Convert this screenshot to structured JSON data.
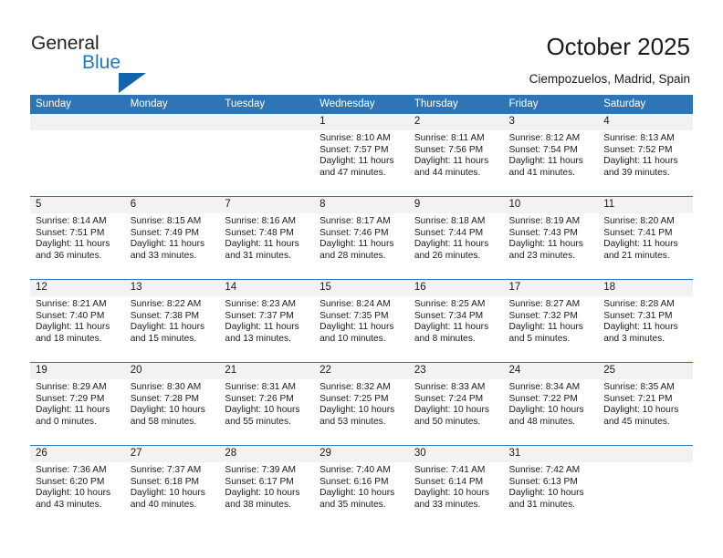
{
  "branding": {
    "line1": "General",
    "line2": "Blue",
    "triangle_color": "#1163ab",
    "blue_text_color": "#1b79c4"
  },
  "header": {
    "title": "October 2025",
    "location": "Ciempozuelos, Madrid, Spain"
  },
  "theme": {
    "header_blue": "#2e75b6",
    "daynum_gray": "#f2f2f2",
    "text": "#1a1a1a"
  },
  "weekday_headers": [
    "Sunday",
    "Monday",
    "Tuesday",
    "Wednesday",
    "Thursday",
    "Friday",
    "Saturday"
  ],
  "weeks": [
    [
      {
        "day": "",
        "sunrise": "",
        "sunset": "",
        "daylight1": "",
        "daylight2": ""
      },
      {
        "day": "",
        "sunrise": "",
        "sunset": "",
        "daylight1": "",
        "daylight2": ""
      },
      {
        "day": "",
        "sunrise": "",
        "sunset": "",
        "daylight1": "",
        "daylight2": ""
      },
      {
        "day": "1",
        "sunrise": "Sunrise: 8:10 AM",
        "sunset": "Sunset: 7:57 PM",
        "daylight1": "Daylight: 11 hours",
        "daylight2": "and 47 minutes."
      },
      {
        "day": "2",
        "sunrise": "Sunrise: 8:11 AM",
        "sunset": "Sunset: 7:56 PM",
        "daylight1": "Daylight: 11 hours",
        "daylight2": "and 44 minutes."
      },
      {
        "day": "3",
        "sunrise": "Sunrise: 8:12 AM",
        "sunset": "Sunset: 7:54 PM",
        "daylight1": "Daylight: 11 hours",
        "daylight2": "and 41 minutes."
      },
      {
        "day": "4",
        "sunrise": "Sunrise: 8:13 AM",
        "sunset": "Sunset: 7:52 PM",
        "daylight1": "Daylight: 11 hours",
        "daylight2": "and 39 minutes."
      }
    ],
    [
      {
        "day": "5",
        "sunrise": "Sunrise: 8:14 AM",
        "sunset": "Sunset: 7:51 PM",
        "daylight1": "Daylight: 11 hours",
        "daylight2": "and 36 minutes."
      },
      {
        "day": "6",
        "sunrise": "Sunrise: 8:15 AM",
        "sunset": "Sunset: 7:49 PM",
        "daylight1": "Daylight: 11 hours",
        "daylight2": "and 33 minutes."
      },
      {
        "day": "7",
        "sunrise": "Sunrise: 8:16 AM",
        "sunset": "Sunset: 7:48 PM",
        "daylight1": "Daylight: 11 hours",
        "daylight2": "and 31 minutes."
      },
      {
        "day": "8",
        "sunrise": "Sunrise: 8:17 AM",
        "sunset": "Sunset: 7:46 PM",
        "daylight1": "Daylight: 11 hours",
        "daylight2": "and 28 minutes."
      },
      {
        "day": "9",
        "sunrise": "Sunrise: 8:18 AM",
        "sunset": "Sunset: 7:44 PM",
        "daylight1": "Daylight: 11 hours",
        "daylight2": "and 26 minutes."
      },
      {
        "day": "10",
        "sunrise": "Sunrise: 8:19 AM",
        "sunset": "Sunset: 7:43 PM",
        "daylight1": "Daylight: 11 hours",
        "daylight2": "and 23 minutes."
      },
      {
        "day": "11",
        "sunrise": "Sunrise: 8:20 AM",
        "sunset": "Sunset: 7:41 PM",
        "daylight1": "Daylight: 11 hours",
        "daylight2": "and 21 minutes."
      }
    ],
    [
      {
        "day": "12",
        "sunrise": "Sunrise: 8:21 AM",
        "sunset": "Sunset: 7:40 PM",
        "daylight1": "Daylight: 11 hours",
        "daylight2": "and 18 minutes."
      },
      {
        "day": "13",
        "sunrise": "Sunrise: 8:22 AM",
        "sunset": "Sunset: 7:38 PM",
        "daylight1": "Daylight: 11 hours",
        "daylight2": "and 15 minutes."
      },
      {
        "day": "14",
        "sunrise": "Sunrise: 8:23 AM",
        "sunset": "Sunset: 7:37 PM",
        "daylight1": "Daylight: 11 hours",
        "daylight2": "and 13 minutes."
      },
      {
        "day": "15",
        "sunrise": "Sunrise: 8:24 AM",
        "sunset": "Sunset: 7:35 PM",
        "daylight1": "Daylight: 11 hours",
        "daylight2": "and 10 minutes."
      },
      {
        "day": "16",
        "sunrise": "Sunrise: 8:25 AM",
        "sunset": "Sunset: 7:34 PM",
        "daylight1": "Daylight: 11 hours",
        "daylight2": "and 8 minutes."
      },
      {
        "day": "17",
        "sunrise": "Sunrise: 8:27 AM",
        "sunset": "Sunset: 7:32 PM",
        "daylight1": "Daylight: 11 hours",
        "daylight2": "and 5 minutes."
      },
      {
        "day": "18",
        "sunrise": "Sunrise: 8:28 AM",
        "sunset": "Sunset: 7:31 PM",
        "daylight1": "Daylight: 11 hours",
        "daylight2": "and 3 minutes."
      }
    ],
    [
      {
        "day": "19",
        "sunrise": "Sunrise: 8:29 AM",
        "sunset": "Sunset: 7:29 PM",
        "daylight1": "Daylight: 11 hours",
        "daylight2": "and 0 minutes."
      },
      {
        "day": "20",
        "sunrise": "Sunrise: 8:30 AM",
        "sunset": "Sunset: 7:28 PM",
        "daylight1": "Daylight: 10 hours",
        "daylight2": "and 58 minutes."
      },
      {
        "day": "21",
        "sunrise": "Sunrise: 8:31 AM",
        "sunset": "Sunset: 7:26 PM",
        "daylight1": "Daylight: 10 hours",
        "daylight2": "and 55 minutes."
      },
      {
        "day": "22",
        "sunrise": "Sunrise: 8:32 AM",
        "sunset": "Sunset: 7:25 PM",
        "daylight1": "Daylight: 10 hours",
        "daylight2": "and 53 minutes."
      },
      {
        "day": "23",
        "sunrise": "Sunrise: 8:33 AM",
        "sunset": "Sunset: 7:24 PM",
        "daylight1": "Daylight: 10 hours",
        "daylight2": "and 50 minutes."
      },
      {
        "day": "24",
        "sunrise": "Sunrise: 8:34 AM",
        "sunset": "Sunset: 7:22 PM",
        "daylight1": "Daylight: 10 hours",
        "daylight2": "and 48 minutes."
      },
      {
        "day": "25",
        "sunrise": "Sunrise: 8:35 AM",
        "sunset": "Sunset: 7:21 PM",
        "daylight1": "Daylight: 10 hours",
        "daylight2": "and 45 minutes."
      }
    ],
    [
      {
        "day": "26",
        "sunrise": "Sunrise: 7:36 AM",
        "sunset": "Sunset: 6:20 PM",
        "daylight1": "Daylight: 10 hours",
        "daylight2": "and 43 minutes."
      },
      {
        "day": "27",
        "sunrise": "Sunrise: 7:37 AM",
        "sunset": "Sunset: 6:18 PM",
        "daylight1": "Daylight: 10 hours",
        "daylight2": "and 40 minutes."
      },
      {
        "day": "28",
        "sunrise": "Sunrise: 7:39 AM",
        "sunset": "Sunset: 6:17 PM",
        "daylight1": "Daylight: 10 hours",
        "daylight2": "and 38 minutes."
      },
      {
        "day": "29",
        "sunrise": "Sunrise: 7:40 AM",
        "sunset": "Sunset: 6:16 PM",
        "daylight1": "Daylight: 10 hours",
        "daylight2": "and 35 minutes."
      },
      {
        "day": "30",
        "sunrise": "Sunrise: 7:41 AM",
        "sunset": "Sunset: 6:14 PM",
        "daylight1": "Daylight: 10 hours",
        "daylight2": "and 33 minutes."
      },
      {
        "day": "31",
        "sunrise": "Sunrise: 7:42 AM",
        "sunset": "Sunset: 6:13 PM",
        "daylight1": "Daylight: 10 hours",
        "daylight2": "and 31 minutes."
      },
      {
        "day": "",
        "sunrise": "",
        "sunset": "",
        "daylight1": "",
        "daylight2": ""
      }
    ]
  ]
}
